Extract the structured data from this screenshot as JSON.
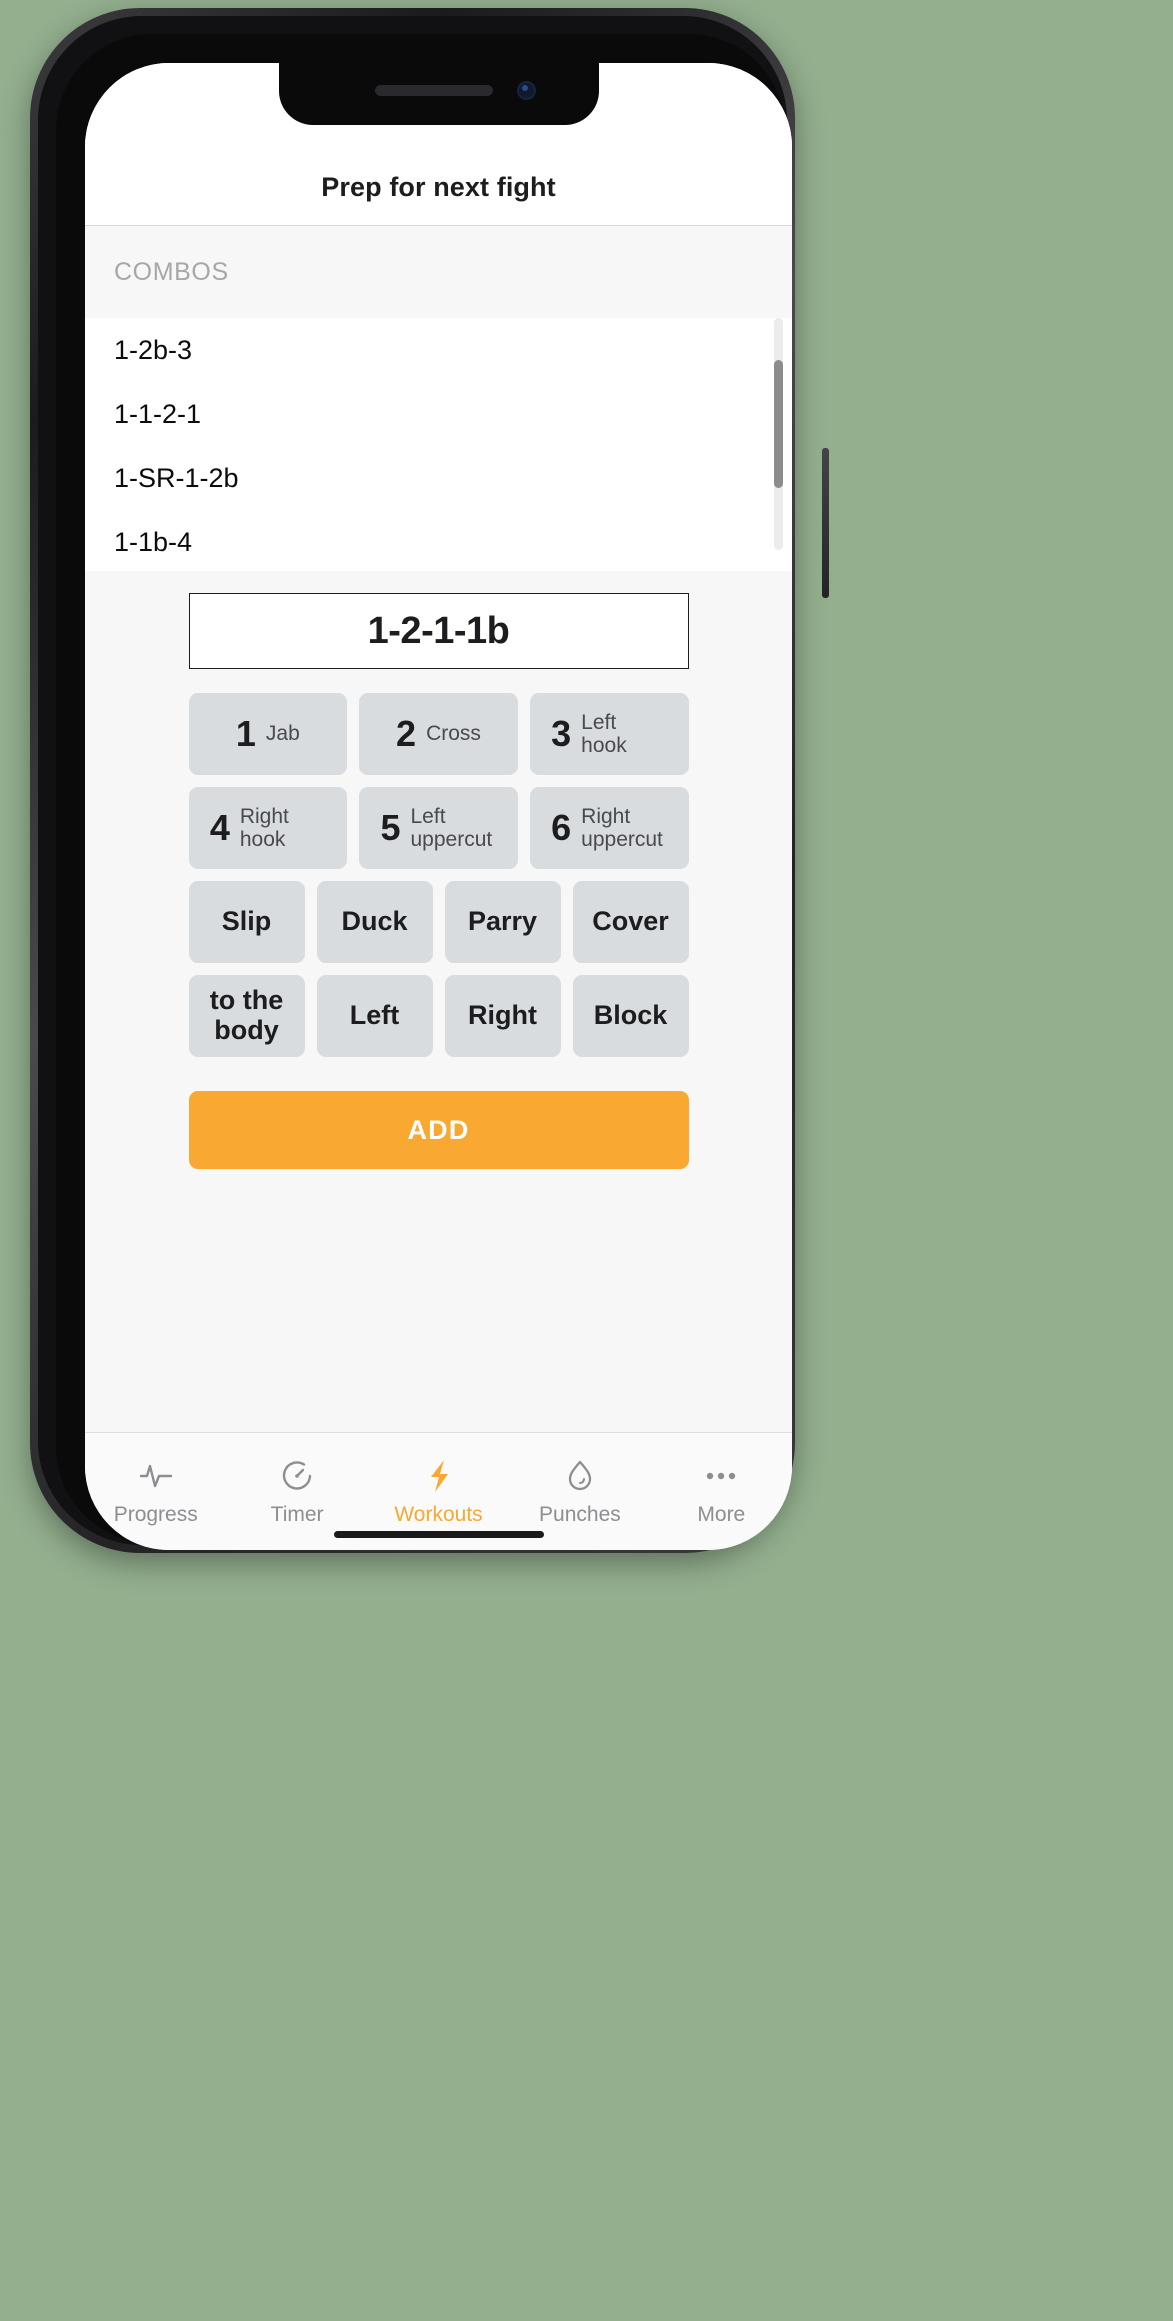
{
  "app": {
    "nav_title": "Prep for next fight"
  },
  "section": {
    "label": "COMBOS"
  },
  "combo_list": {
    "items": [
      {
        "label": "1-2b-3"
      },
      {
        "label": "1-1-2-1"
      },
      {
        "label": "1-SR-1-2b"
      },
      {
        "label": "1-1b-4"
      }
    ]
  },
  "builder": {
    "current_combo": "1-2-1-1b",
    "punches": [
      {
        "num": "1",
        "name": "Jab"
      },
      {
        "num": "2",
        "name": "Cross"
      },
      {
        "num": "3",
        "name": "Left hook"
      },
      {
        "num": "4",
        "name": "Right hook"
      },
      {
        "num": "5",
        "name": "Left uppercut"
      },
      {
        "num": "6",
        "name": "Right uppercut"
      }
    ],
    "defense": [
      {
        "label": "Slip"
      },
      {
        "label": "Duck"
      },
      {
        "label": "Parry"
      },
      {
        "label": "Cover"
      }
    ],
    "modifiers": [
      {
        "label": "to the body"
      },
      {
        "label": "Left"
      },
      {
        "label": "Right"
      },
      {
        "label": "Block"
      }
    ],
    "add_label": "ADD"
  },
  "tabbar": {
    "tabs": [
      {
        "label": "Progress",
        "icon": "pulse-icon",
        "active": false
      },
      {
        "label": "Timer",
        "icon": "timer-icon",
        "active": false
      },
      {
        "label": "Workouts",
        "icon": "bolt-icon",
        "active": true
      },
      {
        "label": "Punches",
        "icon": "glove-icon",
        "active": false
      },
      {
        "label": "More",
        "icon": "ellipsis-icon",
        "active": false
      }
    ]
  },
  "colors": {
    "accent": "#f9a831",
    "pad_bg": "#d8dcdf",
    "inactive": "#8e8e92"
  }
}
